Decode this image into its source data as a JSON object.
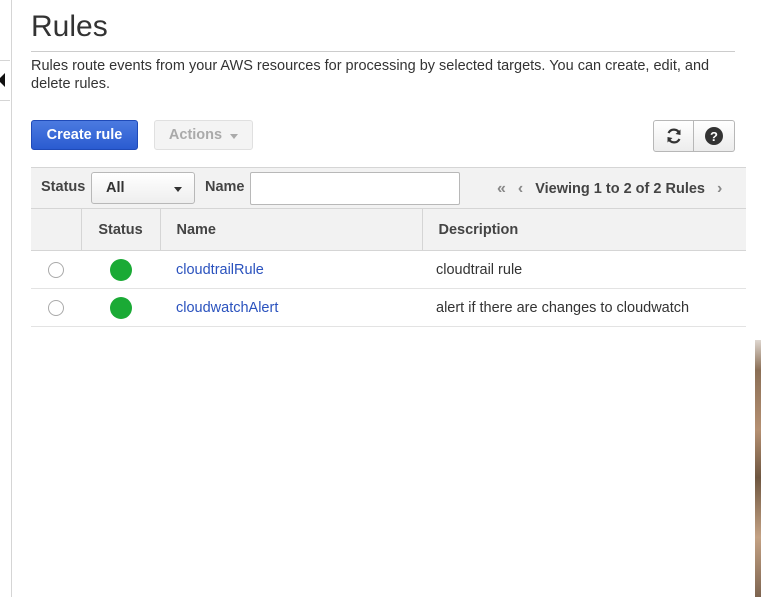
{
  "page": {
    "title": "Rules",
    "description": "Rules route events from your AWS resources for processing by selected targets. You can create, edit, and delete rules."
  },
  "toolbar": {
    "create_label": "Create rule",
    "actions_label": "Actions",
    "refresh_icon": "refresh-icon",
    "help_icon": "help-icon",
    "help_glyph": "?"
  },
  "filter": {
    "status_label": "Status",
    "status_value": "All",
    "name_label": "Name",
    "name_value": "",
    "pager_text": "Viewing 1 to 2 of 2 Rules"
  },
  "table": {
    "columns": [
      "",
      "Status",
      "Name",
      "Description"
    ],
    "rows": [
      {
        "status_color": "#1aaa35",
        "name": "cloudtrailRule",
        "description": "cloudtrail rule"
      },
      {
        "status_color": "#1aaa35",
        "name": "cloudwatchAlert",
        "description": "alert if there are changes to cloudwatch"
      }
    ]
  },
  "colors": {
    "primary": "#2a5bd0",
    "link": "#2a52be",
    "status_enabled": "#1aaa35"
  }
}
